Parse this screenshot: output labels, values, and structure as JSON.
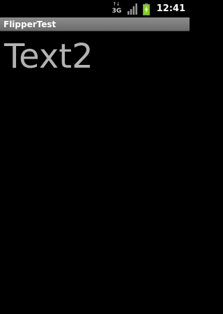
{
  "status_bar": {
    "network_type": "3G",
    "network_arrows": "↑↓",
    "signal_icon": "signal-bars-icon",
    "battery_icon": "battery-charging-icon",
    "time": "12:41"
  },
  "title_bar": {
    "title": "FlipperTest"
  },
  "content": {
    "flipper_text": "Text2"
  },
  "colors": {
    "background": "#000000",
    "title_bar": "#7a7a7a",
    "content_text": "#b3b3b3",
    "battery": "#7bd600"
  }
}
